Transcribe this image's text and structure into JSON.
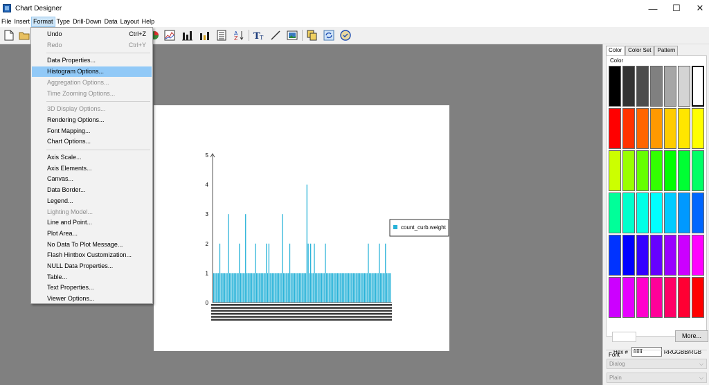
{
  "window": {
    "title": "Chart Designer",
    "controls": {
      "minimize": "—",
      "maximize": "☐",
      "close": "✕"
    }
  },
  "menubar": [
    "File",
    "Insert",
    "Format",
    "Type",
    "Drill-Down",
    "Data",
    "Layout",
    "Help"
  ],
  "active_menu": "Format",
  "format_menu": {
    "items": [
      {
        "label": "Undo",
        "shortcut": "Ctrl+Z",
        "enabled": true
      },
      {
        "label": "Redo",
        "shortcut": "Ctrl+Y",
        "enabled": false
      },
      {
        "sep": true
      },
      {
        "label": "Data Properties...",
        "enabled": true
      },
      {
        "label": "Histogram Options...",
        "enabled": true,
        "highlighted": true
      },
      {
        "label": "Aggregation Options...",
        "enabled": false
      },
      {
        "label": "Time Zooming Options...",
        "enabled": false
      },
      {
        "sep": true
      },
      {
        "label": "3D Display Options...",
        "enabled": false
      },
      {
        "label": "Rendering Options...",
        "enabled": true
      },
      {
        "label": "Font Mapping...",
        "enabled": true
      },
      {
        "label": "Chart Options...",
        "enabled": true
      },
      {
        "sep": true
      },
      {
        "label": "Axis Scale...",
        "enabled": true
      },
      {
        "label": "Axis Elements...",
        "enabled": true
      },
      {
        "label": "Canvas...",
        "enabled": true
      },
      {
        "label": "Data Border...",
        "enabled": true
      },
      {
        "label": "Legend...",
        "enabled": true
      },
      {
        "label": "Lighting Model...",
        "enabled": false
      },
      {
        "label": "Line and Point...",
        "enabled": true
      },
      {
        "label": "Plot Area...",
        "enabled": true
      },
      {
        "label": "No Data To Plot Message...",
        "enabled": true
      },
      {
        "label": "Flash Hintbox Customization...",
        "enabled": true
      },
      {
        "label": "NULL Data Properties...",
        "enabled": true
      },
      {
        "label": "Table...",
        "enabled": true
      },
      {
        "label": "Text Properties...",
        "enabled": true
      },
      {
        "label": "Viewer Options...",
        "enabled": true
      }
    ]
  },
  "toolbar_icons": [
    "new-file-icon",
    "open-folder-icon",
    "pie-chart-icon",
    "line-chart-icon",
    "bar-chart-icon",
    "stacked-bar-icon",
    "list-icon",
    "sort-az-icon",
    "text-icon",
    "line-draw-icon",
    "image-icon",
    "copy-icon",
    "refresh-icon",
    "preview-icon"
  ],
  "chart_data": {
    "type": "bar",
    "y_ticks": [
      "0",
      "1",
      "2",
      "3",
      "4",
      "5"
    ],
    "ylim": [
      0,
      5
    ],
    "legend": {
      "label": "count_curb.weight",
      "position": "right",
      "color": "#27b2d8"
    },
    "series_color": "#27b2d8",
    "values": [
      1,
      1,
      1,
      1,
      1,
      2,
      1,
      1,
      1,
      1,
      1,
      1,
      3,
      1,
      1,
      1,
      1,
      1,
      1,
      1,
      1,
      2,
      1,
      1,
      1,
      1,
      3,
      1,
      1,
      1,
      1,
      1,
      1,
      1,
      2,
      1,
      1,
      1,
      1,
      1,
      1,
      1,
      1,
      2,
      1,
      2,
      1,
      1,
      1,
      1,
      1,
      1,
      1,
      1,
      1,
      1,
      3,
      1,
      1,
      1,
      1,
      1,
      2,
      1,
      1,
      1,
      1,
      1,
      1,
      1,
      1,
      1,
      1,
      1,
      1,
      1,
      4,
      2,
      1,
      2,
      1,
      1,
      2,
      1,
      1,
      1,
      1,
      1,
      1,
      1,
      1,
      2,
      1,
      1,
      1,
      1,
      1,
      1,
      1,
      1,
      1,
      1,
      1,
      1,
      1,
      1,
      1,
      1,
      1,
      1,
      1,
      1,
      1,
      1,
      1,
      1,
      1,
      1,
      1,
      1,
      1,
      1,
      1,
      1,
      1,
      1,
      2,
      1,
      1,
      1,
      1,
      1,
      1,
      1,
      1,
      2,
      1,
      1,
      1,
      1,
      2,
      1,
      1,
      1,
      1
    ]
  },
  "right_panel": {
    "tabs": [
      "Color",
      "Color Set",
      "Pattern"
    ],
    "color_label": "Color",
    "more_button": "More...",
    "hex_label": "Hex #",
    "hex_value": "ffffff",
    "hex_format": "RRGGBB/RGB",
    "font_label": "Font",
    "font_family": "Dialog",
    "font_style": "Plain",
    "palette": [
      [
        "#000000",
        "#333333",
        "#4d4d4d",
        "#808080",
        "#a6a6a6",
        "#d4d4d4",
        "#ffffff"
      ],
      [
        "#ff0000",
        "#ff3300",
        "#ff6600",
        "#ff9900",
        "#ffcc00",
        "#ffe600",
        "#ffff00"
      ],
      [
        "#ccff00",
        "#99ff00",
        "#66ff00",
        "#33ff00",
        "#00ff00",
        "#00ff33",
        "#00ff66"
      ],
      [
        "#00ff99",
        "#00ffcc",
        "#00ffe6",
        "#00ffff",
        "#00ccff",
        "#0099ff",
        "#0066ff"
      ],
      [
        "#0033ff",
        "#0000ff",
        "#3300ff",
        "#6600ff",
        "#9900ff",
        "#cc00ff",
        "#ff00ff"
      ],
      [
        "#cc00ff",
        "#e600ff",
        "#ff00cc",
        "#ff0099",
        "#ff0066",
        "#ff0033",
        "#ff0000"
      ]
    ]
  }
}
